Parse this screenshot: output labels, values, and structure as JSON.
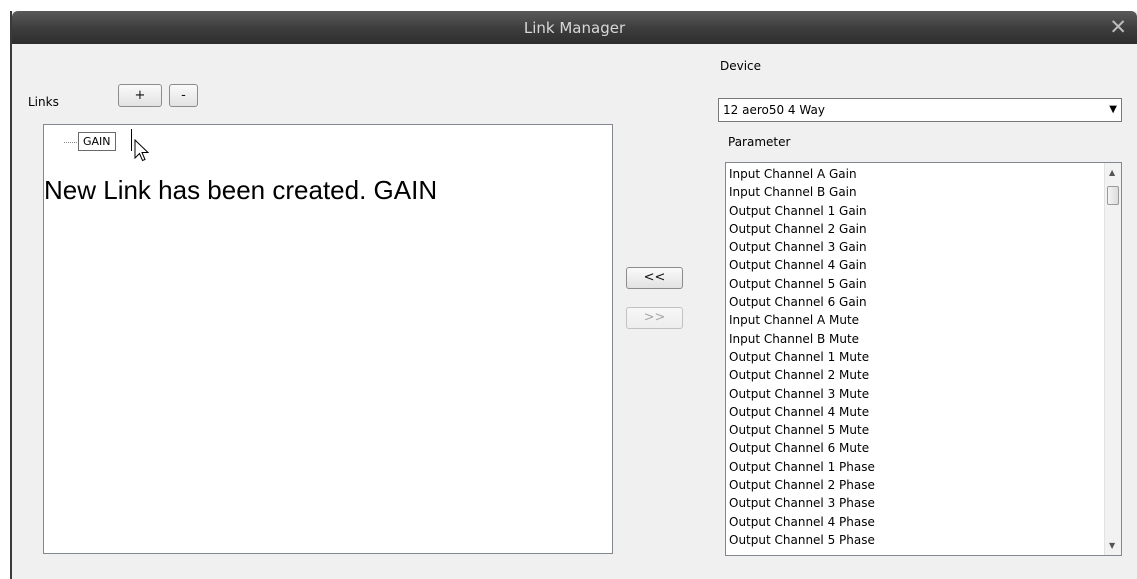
{
  "window": {
    "title": "Link Manager",
    "close_glyph": "✕"
  },
  "links": {
    "label": "Links",
    "add_label": "+",
    "remove_label": "-",
    "tree_item": "GAIN",
    "message": "New Link has been created. GAIN"
  },
  "transfer": {
    "left_label": "<<",
    "right_label": ">>"
  },
  "device": {
    "label": "Device",
    "selected": "12 aero50 4 Way",
    "arrow": "▼"
  },
  "parameter": {
    "label": "Parameter",
    "items": [
      "Input Channel A Gain",
      "Input Channel B Gain",
      "Output Channel 1 Gain",
      "Output Channel 2 Gain",
      "Output Channel 3 Gain",
      "Output Channel 4 Gain",
      "Output Channel 5 Gain",
      "Output Channel 6 Gain",
      "Input Channel A Mute",
      "Input Channel B Mute",
      "Output Channel 1 Mute",
      "Output Channel 2 Mute",
      "Output Channel 3 Mute",
      "Output Channel 4 Mute",
      "Output Channel 5 Mute",
      "Output Channel 6 Mute",
      "Output Channel 1 Phase",
      "Output Channel 2 Phase",
      "Output Channel 3 Phase",
      "Output Channel 4 Phase",
      "Output Channel 5 Phase"
    ]
  }
}
